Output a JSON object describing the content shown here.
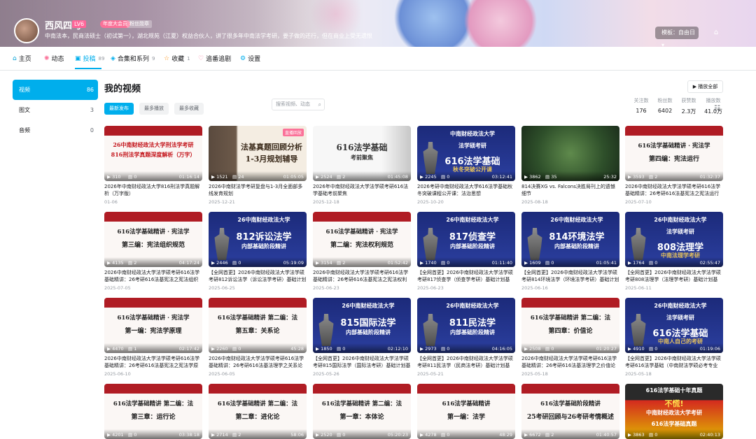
{
  "header": {
    "username": "西风四马",
    "level": "LV6",
    "vip": "年度大会员",
    "medal": "粉丝勋章",
    "signature": "中南法本，民商法硕士（初试第一），湖北规苑（江夏）权益合伙人，讲了很多年中南法学考研，要子做的还行，但在商业上受无遗恨",
    "mode_button": "模板：自由日",
    "gift_icon": "gift-icon"
  },
  "nav": {
    "items": [
      {
        "label": "主页",
        "icon": "home-icon",
        "count": ""
      },
      {
        "label": "动态",
        "icon": "dynamic-icon",
        "count": ""
      },
      {
        "label": "投稿",
        "icon": "upload-icon",
        "count": "89"
      },
      {
        "label": "合集和系列",
        "icon": "collection-icon",
        "count": "9"
      },
      {
        "label": "收藏",
        "icon": "star-icon",
        "count": "1"
      },
      {
        "label": "追番追剧",
        "icon": "heart-icon",
        "count": ""
      },
      {
        "label": "设置",
        "icon": "settings-icon",
        "count": ""
      }
    ],
    "search_placeholder": "搜索视频、动态"
  },
  "stats": [
    {
      "label": "关注数",
      "value": "176"
    },
    {
      "label": "粉丝数",
      "value": "6402"
    },
    {
      "label": "获赞数",
      "value": "2.3万"
    },
    {
      "label": "播放数",
      "value": "41.0万"
    }
  ],
  "sidebar": [
    {
      "label": "视频",
      "count": "86"
    },
    {
      "label": "图文",
      "count": "3"
    },
    {
      "label": "音频",
      "count": "0"
    }
  ],
  "main": {
    "title": "我的视频",
    "play_all": "▶ 播放全部",
    "sort": [
      "最新发布",
      "最多播放",
      "最多收藏"
    ]
  },
  "videos": [
    {
      "thumb_text": [
        "26中南财经政法大学刑法学考研",
        "816刑法学真题深度解析（万字）"
      ],
      "plays": "310",
      "danmaku": "0",
      "duration": "01:16:14",
      "title": "2026年中南财经政法大学816刑法学真题解析（万字版）",
      "date": "01-06"
    },
    {
      "thumb_text": [
        "法基真题回顾分析",
        "1-3月规划辅导"
      ],
      "tag": "直播回放",
      "plays": "1521",
      "danmaku": "24",
      "duration": "01:05:05",
      "title": "2026中南财法学考研复盘与1-3月全面部多线发育规划",
      "date": "2025-12-21"
    },
    {
      "thumb_text": [
        "616法学基础",
        "考前聚焦"
      ],
      "plays": "2524",
      "danmaku": "2",
      "duration": "01:45:08",
      "title": "2026年中南财经政法大学法学硕考研616法学基础考前聚焦",
      "date": "2025-12-18"
    },
    {
      "thumb_text": [
        "中南财经政法大学",
        "法学硕考研",
        "616法学基础",
        "秋冬突破公开课"
      ],
      "plays": "2245",
      "danmaku": "0",
      "duration": "03:12:41",
      "title": "2026考研中南财经政法大学616法学基础秋冬突破课程公开课：法治思想",
      "date": "2025-10-20"
    },
    {
      "thumb_text": [],
      "plays": "3862",
      "danmaku": "35",
      "duration": "25:32",
      "title": "814决赛XG vs. Falcons决胜局刊上的遗憾细节",
      "date": "2025-08-18"
    },
    {
      "thumb_text": [
        "616法学基础精讲 · 宪法学",
        "第四编：宪法运行"
      ],
      "plays": "3593",
      "danmaku": "2",
      "duration": "01:32:37",
      "title": "2026中南财经政法大学法学硕考研616法学基础精讲：26考研616法基宪法之宪法运行",
      "date": "2025-07-10"
    },
    {
      "thumb_text": [
        "616法学基础精讲 · 宪法学",
        "第三编：宪法组织规范"
      ],
      "plays": "4135",
      "danmaku": "2",
      "duration": "04:17:24",
      "title": "2026中南财经政法大学法学硕考研616法学基础精讲：26考研616法基宪法之宪法组织规范",
      "date": "2025-07-05"
    },
    {
      "thumb_text": [
        "26中南财经政法大学",
        "812诉讼法学",
        "内部基础阶段精讲"
      ],
      "plays": "2446",
      "danmaku": "0",
      "duration": "05:19:09",
      "title": "【全网首更】2026中南财经政法大学法学硕考研812诉讼法学（诉讼法学考研）基础计划基...",
      "date": "2025-06-25"
    },
    {
      "thumb_text": [
        "616法学基础精讲 · 宪法学",
        "第二编：宪法权利规范"
      ],
      "plays": "3154",
      "danmaku": "2",
      "duration": "01:52:42",
      "title": "2026中南财经政法大学法学硕考研616法学基础精讲：26考研616法基宪法之宪法权利规范",
      "date": "2025-06-23"
    },
    {
      "thumb_text": [
        "26中南财经政法大学",
        "817侦查学",
        "内部基础阶段精讲"
      ],
      "plays": "1740",
      "danmaku": "0",
      "duration": "01:11:40",
      "title": "【全网首更】2026中南财经政法大学法学硕考研817侦查学（侦查学考研）基础计划基础...",
      "date": "2025-06-23"
    },
    {
      "thumb_text": [
        "26中南财经政法大学",
        "814环境法学",
        "内部基础阶段精讲"
      ],
      "plays": "1609",
      "danmaku": "0",
      "duration": "01:05:41",
      "title": "【全网首更】2026中南财经政法大学法学硕考研814环境法学（环境法学考研）基础计划基...",
      "date": "2025-06-16"
    },
    {
      "thumb_text": [
        "26中南财经政法大学",
        "法学硕考研",
        "808法理学",
        "中南法理学考研"
      ],
      "plays": "1764",
      "danmaku": "0",
      "duration": "02:55:47",
      "title": "【全网首更】2026中南财经政法大学法学硕考研808法理学（法理学考研）基础计划基础...",
      "date": "2025-06-11"
    },
    {
      "thumb_text": [
        "616法学基础精讲 · 宪法学",
        "第一编：宪法学原理"
      ],
      "plays": "4470",
      "danmaku": "1",
      "duration": "02:17:42",
      "title": "2026中南财经政法大学法学硕考研616法学基础精讲：26考研616法基宪法之宪法学原理",
      "date": "2025-06-10"
    },
    {
      "thumb_text": [
        "616法学基础精讲 第二编：法",
        "第五章：关系论"
      ],
      "plays": "2260",
      "danmaku": "0",
      "duration": "45:28",
      "title": "2026中南财经政法大学法学硕考研616法学基础精讲：26考研616法基法理学之关系论",
      "date": "2025-06-05"
    },
    {
      "thumb_text": [
        "26中南财经政法大学",
        "815国际法学",
        "内部基础阶段精讲"
      ],
      "plays": "1850",
      "danmaku": "0",
      "duration": "02:12:10",
      "title": "【全网首更】2026中南财经政法大学法学硕考研815国际法学（国际法考研）基础计划基础...",
      "date": "2025-05-26"
    },
    {
      "thumb_text": [
        "26中南财经政法大学",
        "811民法学",
        "内部基础阶段精讲"
      ],
      "plays": "2973",
      "danmaku": "0",
      "duration": "04:16:05",
      "title": "【全网首更】2026中南财经政法大学法学硕考研811民法学（民商法考研）基础计划基础...",
      "date": "2025-05-21"
    },
    {
      "thumb_text": [
        "616法学基础精讲 第二编：法",
        "第四章：价值论"
      ],
      "plays": "2508",
      "danmaku": "0",
      "duration": "01:20:27",
      "title": "2026中南财经政法大学法学硕考研616法学基础精讲：26考研616法基法理学之价值论",
      "date": "2025-05-18"
    },
    {
      "thumb_text": [
        "26中南财经政法大学",
        "法学硕考研",
        "616法学基础",
        "中南人自己的考研"
      ],
      "plays": "4910",
      "danmaku": "0",
      "duration": "01:19:06",
      "title": "【全网首更】2026中南财经政法大学法学硕考研616法学基础（中南财法学硕必考专业课...",
      "date": "2025-05-18"
    },
    {
      "thumb_text": [
        "616法学基础精讲 第二编：法",
        "第三章：运行论"
      ],
      "plays": "4201",
      "danmaku": "0",
      "duration": "03:38:18",
      "title": "",
      "date": ""
    },
    {
      "thumb_text": [
        "616法学基础精讲 第二编：法",
        "第二章：进化论"
      ],
      "plays": "2714",
      "danmaku": "2",
      "duration": "58:06",
      "title": "",
      "date": ""
    },
    {
      "thumb_text": [
        "616法学基础精讲 第二编：法",
        "第一章：本体论"
      ],
      "plays": "2520",
      "danmaku": "0",
      "duration": "05:20:23",
      "title": "",
      "date": ""
    },
    {
      "thumb_text": [
        "616法学基础精讲",
        "第一编：法学"
      ],
      "plays": "4278",
      "danmaku": "0",
      "duration": "48:29",
      "title": "",
      "date": ""
    },
    {
      "thumb_text": [
        "616法学基础阶段精讲",
        "25考研回顾与26考研考情概述"
      ],
      "plays": "6672",
      "danmaku": "2",
      "duration": "01:40:57",
      "title": "",
      "date": ""
    },
    {
      "thumb_text": [
        "616法学基础十年真题",
        "不慌!",
        "中南财经政法大学考研",
        "616法学基础真题"
      ],
      "plays": "3863",
      "danmaku": "0",
      "duration": "02:40:13",
      "title": "",
      "date": ""
    }
  ],
  "colors": {
    "accent": "#00aeec",
    "pink": "#fb7299",
    "navy": "#1d2a78",
    "red": "#b01c24"
  }
}
